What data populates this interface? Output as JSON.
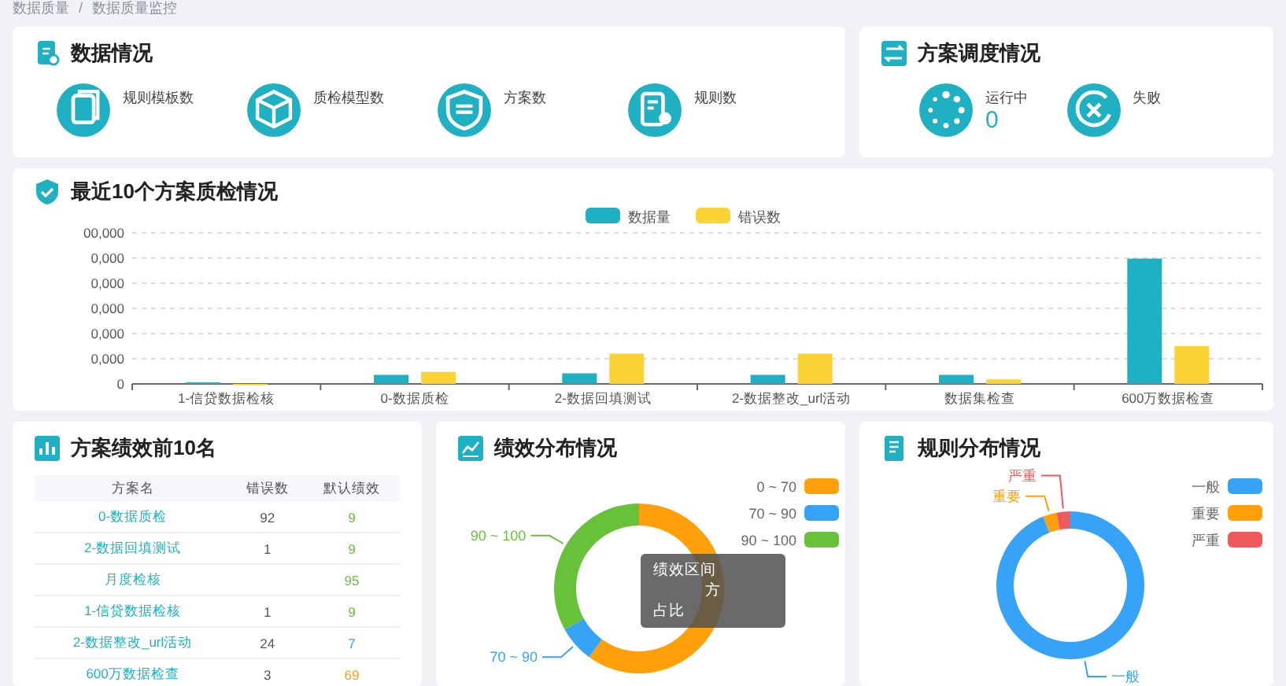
{
  "breadcrumb": [
    "数据质量",
    "/",
    "数据质量监控"
  ],
  "data_overview": {
    "title": "数据情况",
    "items": [
      {
        "label": "规则模板数"
      },
      {
        "label": "质检模型数"
      },
      {
        "label": "方案数"
      },
      {
        "label": "规则数"
      }
    ]
  },
  "schedule": {
    "title": "方案调度情况",
    "items": [
      {
        "label": "运行中",
        "value": "0"
      },
      {
        "label": "失败"
      }
    ]
  },
  "recent_checks": {
    "title": "最近10个方案质检情况",
    "categories": [
      "1-信贷数据检核",
      "0-数据质检",
      "2-数据回填测试",
      "2-数据整改_url活动",
      "数据集检查",
      "600万数据检查"
    ],
    "series": [
      {
        "name": "数据量",
        "color": "#1fb0c3"
      },
      {
        "name": "错误数",
        "color": "#fbd335"
      }
    ],
    "y_axis_labels": [
      "00,000",
      "0,000",
      "0,000",
      "0,000",
      "0,000",
      "0,000",
      "0"
    ]
  },
  "top10": {
    "title": "方案绩效前10名",
    "columns": [
      "方案名",
      "错误数",
      "默认绩效"
    ],
    "rows": [
      {
        "name": "0-数据质检",
        "errors": "92",
        "score": "9",
        "color": "#67c23a"
      },
      {
        "name": "2-数据回填测试",
        "errors": "1",
        "score": "9",
        "color": "#67c23a"
      },
      {
        "name": "月度检核",
        "score": "95",
        "color": "#67c23a"
      },
      {
        "name": "1-信贷数据检核",
        "errors": "1",
        "score": "9",
        "color": "#67c23a"
      },
      {
        "name": "2-数据整改_url活动",
        "errors": "24",
        "score": "7",
        "color": "#409eff"
      },
      {
        "name": "600万数据检查",
        "errors": "3",
        "score": "69",
        "color": "#ff9f0a"
      }
    ]
  },
  "performance_distribution": {
    "title": "绩效分布情况",
    "slices": [
      {
        "color": "#ff9f0a"
      },
      {
        "color": "#36a3f7"
      },
      {
        "color": "#67c23a"
      }
    ],
    "callouts": [
      {
        "label": "90 ~ 100",
        "color": "#67c23a"
      },
      {
        "label": "70 ~ 90",
        "color": "#36a3f7"
      }
    ],
    "chart_data": {
      "type": "donut",
      "categories": [
        "0 ~ 70",
        "70 ~ 90",
        "90 ~ 100"
      ],
      "values": [
        60,
        7,
        33
      ],
      "legend": "top-right"
    },
    "tooltip": {
      "lines": [
        "绩效区间",
        "方",
        "占比"
      ]
    }
  },
  "rule_distribution": {
    "title": "规则分布情况",
    "slices": [
      {
        "color": "#36a3f7"
      },
      {
        "color": "#ff9f0a"
      },
      {
        "color": "#f05a5a"
      }
    ],
    "callouts": [
      {
        "label": "严重",
        "color": "#f05a5a"
      },
      {
        "label": "重要",
        "color": "#ff9f0a"
      },
      {
        "label": "一般",
        "color": "#36a3f7"
      }
    ],
    "chart_data": {
      "type": "donut",
      "categories": [
        "一般",
        "重要",
        "严重"
      ],
      "values": [
        94,
        3,
        3
      ],
      "legend": "top-right"
    }
  }
}
